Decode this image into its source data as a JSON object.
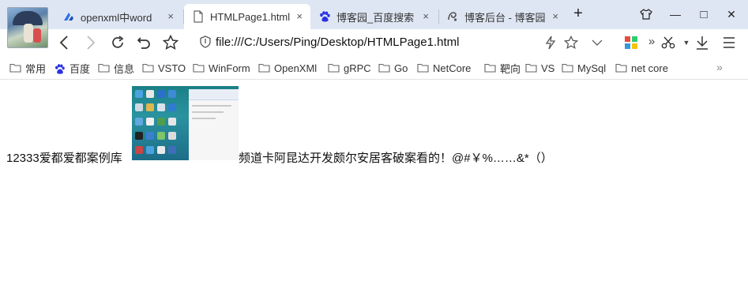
{
  "tabs": [
    {
      "label": "openxml中word",
      "close": "×",
      "icon": "openxml-favicon",
      "active": false
    },
    {
      "label": "HTMLPage1.html",
      "close": "×",
      "icon": "page-icon",
      "active": true
    },
    {
      "label": "博客园_百度搜索",
      "close": "×",
      "icon": "baidu-paw-icon",
      "active": false
    },
    {
      "label": "博客后台 - 博客园",
      "close": "×",
      "icon": "cnblogs-icon",
      "active": false
    }
  ],
  "new_tab": "+",
  "window_controls": {
    "minimize": "—",
    "maximize": "□",
    "close": "✕"
  },
  "address": {
    "url": "file:///C:/Users/Ping/Desktop/HTMLPage1.html"
  },
  "bookmarks": [
    {
      "label": "常用",
      "icon": "folder-icon"
    },
    {
      "label": "百度",
      "icon": "baidu-paw-icon"
    },
    {
      "label": "信息",
      "icon": "folder-icon"
    },
    {
      "label": "VSTO",
      "icon": "folder-icon"
    },
    {
      "label": "WinForm",
      "icon": "folder-icon"
    },
    {
      "label": "OpenXMl",
      "icon": "folder-icon"
    },
    {
      "label": "gRPC",
      "icon": "folder-icon"
    },
    {
      "label": "Go",
      "icon": "folder-icon"
    },
    {
      "label": "NetCore",
      "icon": "folder-icon"
    },
    {
      "label": "靶向",
      "icon": "folder-icon"
    },
    {
      "label": "VS",
      "icon": "folder-icon"
    },
    {
      "label": "MySql",
      "icon": "folder-icon"
    },
    {
      "label": "net core",
      "icon": "folder-icon"
    }
  ],
  "bookmarks_more": "»",
  "page": {
    "text_before": "12333爱都爱都案例库",
    "text_after": "频道卡阿昆达开发颇尔安居客破案看的！@#￥%……&*（）"
  },
  "colors": {
    "tabstrip": "#dfe6f3",
    "accent_blue": "#2d6fe8",
    "baidu_blue": "#2932e1"
  }
}
